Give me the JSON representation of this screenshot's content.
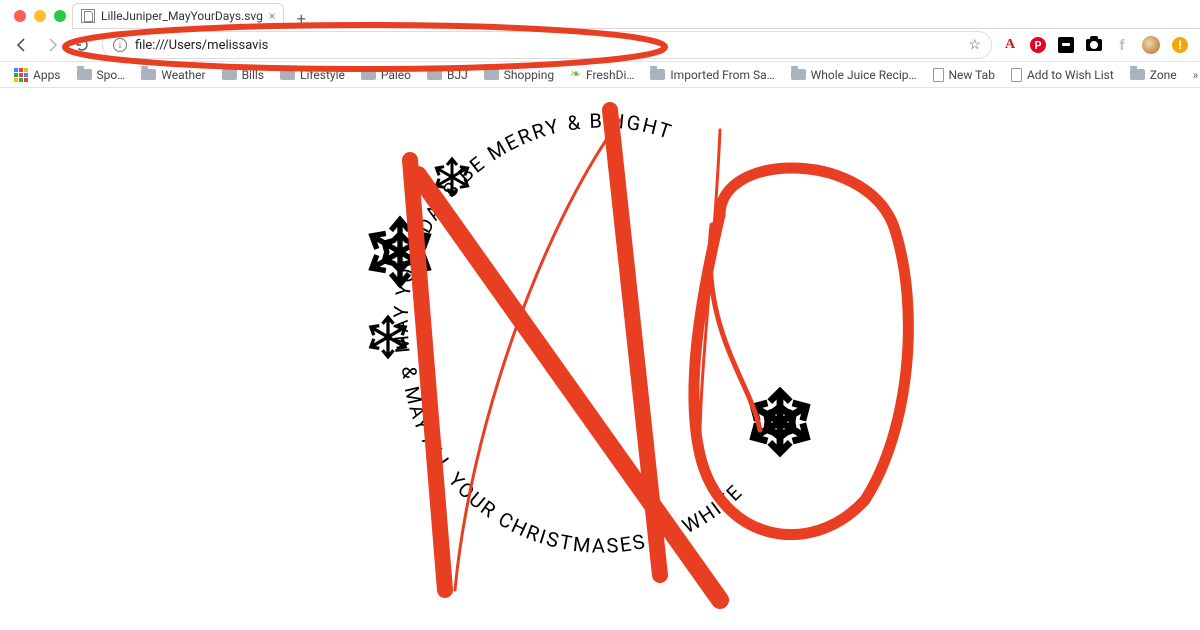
{
  "window": {
    "tab_title": "LilleJuniper_MayYourDays.svg",
    "url": "file:///Users/melissavis"
  },
  "bookmarks_bar": {
    "apps_label": "Apps",
    "items": [
      {
        "type": "folder",
        "label": "Spo…"
      },
      {
        "type": "folder",
        "label": "Weather"
      },
      {
        "type": "folder",
        "label": "Bills"
      },
      {
        "type": "folder",
        "label": "Lifestyle"
      },
      {
        "type": "folder",
        "label": "Paleo"
      },
      {
        "type": "folder",
        "label": "BJJ"
      },
      {
        "type": "folder",
        "label": "Shopping"
      },
      {
        "type": "leaf",
        "label": "FreshDi…"
      },
      {
        "type": "folder",
        "label": "Imported From Sa…"
      },
      {
        "type": "folder",
        "label": "Whole Juice Recip…"
      },
      {
        "type": "page",
        "label": "New Tab"
      },
      {
        "type": "page",
        "label": "Add to Wish List"
      },
      {
        "type": "folder",
        "label": "Zone"
      }
    ],
    "overflow": "»"
  },
  "svg_content": {
    "top_arc": "MAY YOUR DAYS BE MERRY & BRIGHT",
    "bottom_arc": "& MAY ALL YOUR CHRISTMASES BE WHITE"
  },
  "annotation": {
    "word": "NO",
    "color": "#e83e22"
  }
}
